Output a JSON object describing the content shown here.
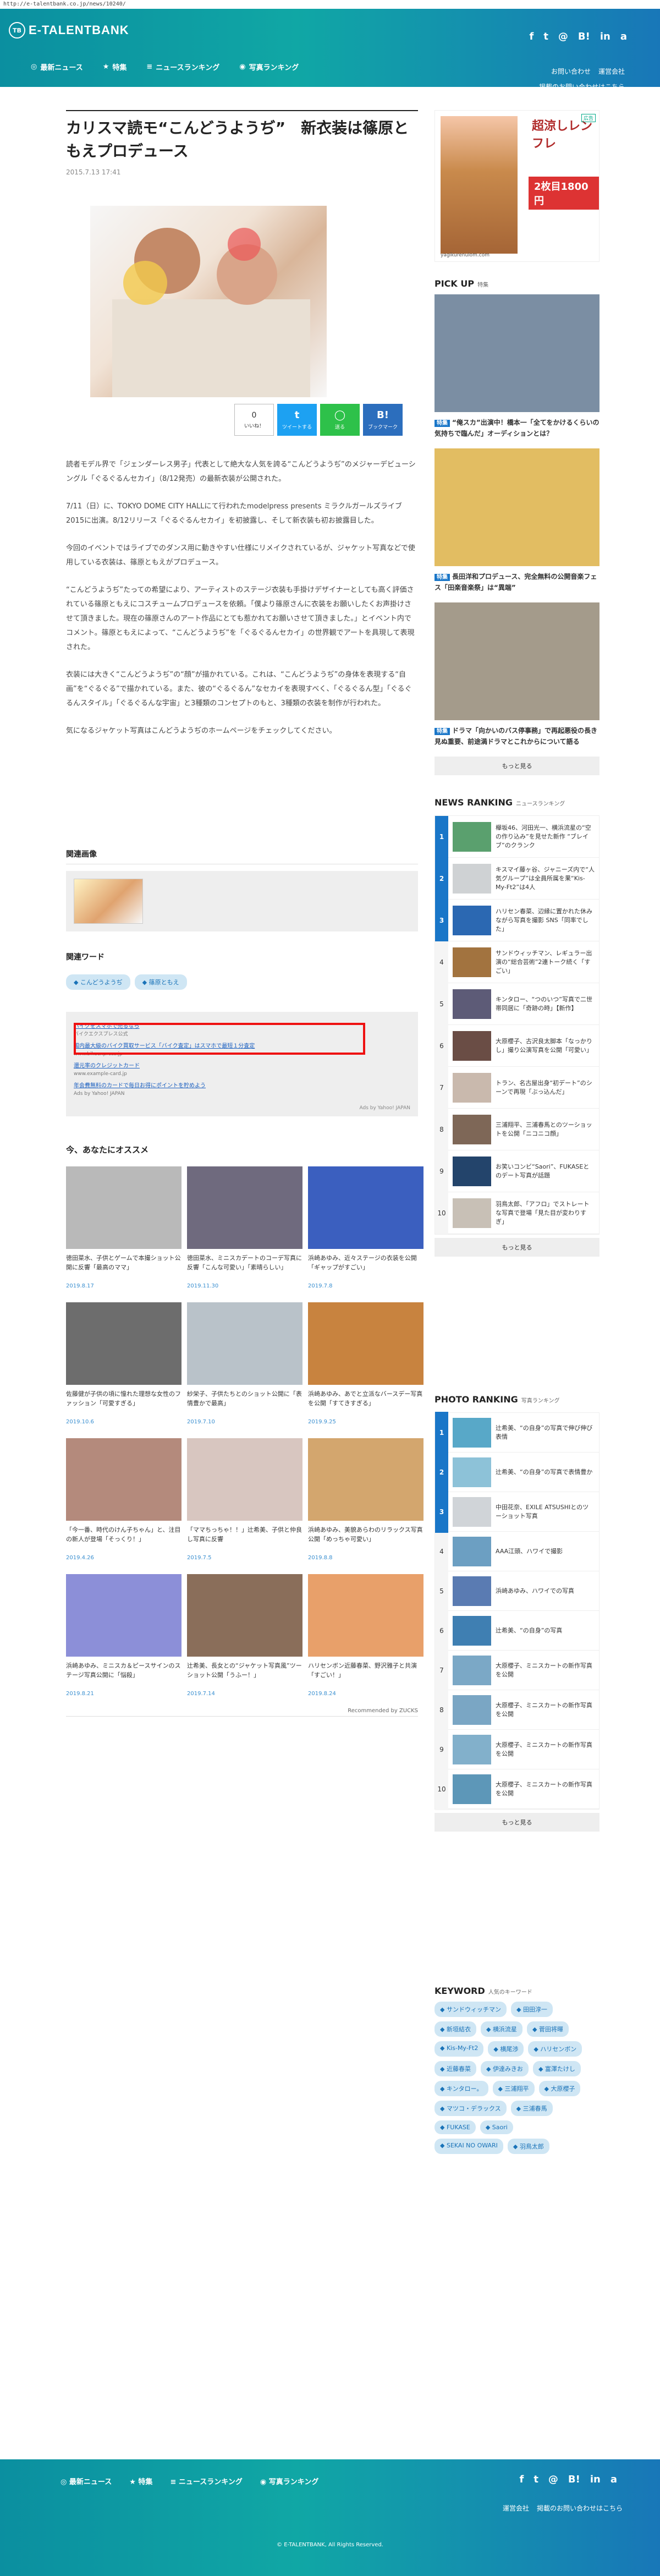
{
  "url": "http://e-talentbank.co.jp/news/10240/",
  "header": {
    "logo_mark": "TB",
    "logo_text": "E-TALENTBANK",
    "nav": [
      "最新ニュース",
      "特集",
      "ニュースランキング",
      "写真ランキング"
    ],
    "social": [
      "f",
      "t",
      "@",
      "B!",
      "in",
      "a"
    ],
    "links": [
      "お問い合わせ",
      "運営会社",
      "掲載のお問い合わせはこちら"
    ]
  },
  "article": {
    "title": "カリスマ読モ“こんどうようぢ”　新衣装は篠原ともえプロデュース",
    "date": "2015.7.13 17:41",
    "share": {
      "count": "0",
      "like_label": "いいね！",
      "tweet_label": "ツイートする",
      "line_label": "送る",
      "hatena_label": "ブックマーク"
    },
    "body": [
      "読者モデル界で「ジェンダーレス男子」代表として絶大な人気を誇る“こんどうようぢ”のメジャーデビューシングル「ぐるぐるんセカイ」（8/12発売）の最新衣装が公開された。",
      "7/11（日）に、TOKYO DOME CITY HALLにて行われたmodelpress presents ミラクルガールズライブ2015に出演。8/12リリース「ぐるぐるんセカイ」を初披露し、そして新衣装も初お披露目した。",
      "今回のイベントではライブでのダンス用に動きやすい仕様にリメイクされているが、ジャケット写真などで使用している衣装は、篠原ともえがプロデュース。",
      "“こんどうようぢ”たっての希望により、アーティストのステージ衣装も手掛けデザイナーとしても高く評価されている篠原ともえにコスチュームプロデュースを依頼。「僕より篠原さんに衣装をお願いしたくお声掛けさせて頂きました。現在の篠原さんのアート作品にとても惹かれてお願いさせて頂きました。」とイベント内でコメント。篠原ともえによって、“こんどうようぢ”を「ぐるぐるんセカイ」の世界観でアートを具現して表現された。",
      "衣装には大きく“こんどうようぢ”の“顔”が描かれている。これは、“こんどうようぢ”の身体を表現する“自画”を“ぐるぐる”で描かれている。また、彼の“ぐるぐるん”なセカイを表現すべく、「ぐるぐるん型」「ぐるぐるんスタイル」「ぐるぐるんな宇宙」と3種類のコンセプトのもと、3種類の衣装を制作が行われた。",
      "気になるジャケット写真はこんどうようぢのホームページをチェックしてください。"
    ]
  },
  "related": {
    "heading": "関連画像",
    "words_heading": "関連ワード",
    "tags": [
      "こんどうようぢ",
      "篠原ともえ"
    ]
  },
  "ad": {
    "lines": [
      {
        "title": "バイクをスマホで売るなら",
        "sub": "バイクエクスプレス公式"
      },
      {
        "title": "国内最大級のバイク買取サービス「バイク査定」はスマホで最短１分査定",
        "sub": "www.bikeexpress.jp"
      },
      {
        "title": "還元率のクレジットカード",
        "sub": "www.example-card.jp"
      },
      {
        "title": "年会費無料のカードで毎日お得にポイントを貯めよう",
        "sub": "Ads by Yahoo! JAPAN"
      }
    ],
    "ads_by": "Ads by Yahoo! JAPAN"
  },
  "recommend": {
    "heading": "今、あなたにオススメ",
    "items": [
      {
        "caption": "徳田菜水、子供とゲームで本撮ショット公開に反響「最高のママ」",
        "date": "2019.8.17",
        "color": "#b9b9b9"
      },
      {
        "caption": "徳田菜水、ミニスカデートのコーデ写真に反響「こんな可愛い」「素晴らしい」",
        "date": "2019.11.30",
        "color": "#6f6a7e"
      },
      {
        "caption": "浜崎あゆみ、近々ステージの衣装を公開「ギャップがすごい」",
        "date": "2019.7.8",
        "color": "#3b5fbf"
      },
      {
        "caption": "佐藤健が子供の頃に憧れた理想な女性のファッション「可愛すぎる」",
        "date": "2019.10.6",
        "color": "#6d6d6d"
      },
      {
        "caption": "紗栄子、子供たちとのショット公開に「表情豊かで最高」",
        "date": "2019.7.10",
        "color": "#b9c2c9"
      },
      {
        "caption": "浜崎あゆみ、あでと立派なバースデー写真を公開「すてきすぎる」",
        "date": "2019.9.25",
        "color": "#c8833f"
      },
      {
        "caption": "「今一番、時代のけん子ちゃん」と、注目の新人が登場「そっくり！」",
        "date": "2019.4.26",
        "color": "#b48a7c"
      },
      {
        "caption": "「ママちっちゃ！！」辻希美、子供と仲良し写真に反響",
        "date": "2019.7.5",
        "color": "#d8c6c0"
      },
      {
        "caption": "浜崎あゆみ、美貌あらわのリラックス写真公開「めっちゃ可愛い」",
        "date": "2019.8.8",
        "color": "#d3a66e"
      },
      {
        "caption": "浜崎あゆみ、ミニスカ＆ピースサインのステージ写真公開に「悩殺」",
        "date": "2019.8.21",
        "color": "#8c8fd8"
      },
      {
        "caption": "辻希美、長女との“ジャケット写真風”ツーショット公開「うふー！」",
        "date": "2019.7.14",
        "color": "#8a6e5a"
      },
      {
        "caption": "ハリセンボン近藤春菜、野沢雅子と共演「すごい！」",
        "date": "2019.8.24",
        "color": "#e8a06a"
      }
    ],
    "powered": "Recommended by ZUCKS"
  },
  "sidebar": {
    "ad": {
      "headline": "超涼しレンフレ",
      "price": "2枚目1800円",
      "domain": "yagikurenulom.com",
      "tag": "広告"
    },
    "pickup": {
      "heading": "PICK UP",
      "sub": "特集",
      "badge": "特集",
      "items": [
        {
          "caption": "“俺スカ”出演中！橋本一「全てをかけるくらいの気持ちで臨んだ」オーディションとは？",
          "color": "#7b8ea3"
        },
        {
          "caption": "長田洋和プロデュース、完全無料の公開音楽フェス「田楽音楽祭」は“異端”",
          "color": "#e2bd62"
        },
        {
          "caption": "ドラマ「向かいのバス停事務」で再起悪役の長き見ぬ重要、前途満ドラマとこれからについて語る",
          "color": "#a49b8b"
        }
      ],
      "more": "もっと見る"
    },
    "news_ranking": {
      "heading": "NEWS RANKING",
      "sub": "ニュースランキング",
      "items": [
        {
          "rank": "1",
          "text": "欅坂46、河田光一、横浜流星の“空の作り込み”を見せた新作 “ブレイブ”のクランク",
          "color": "#5aa06e"
        },
        {
          "rank": "2",
          "text": "キスマイ藤ヶ谷、ジャニーズ内で“人気グループ”は全員所属を果“Kis-My-Ft2”は4人",
          "color": "#cfd2d4"
        },
        {
          "rank": "3",
          "text": "ハリセン春菜、辺縁に置かれた休みながら写真を撮影 SNS「同率でした」",
          "color": "#2b68b2"
        },
        {
          "rank": "4",
          "text": "サンドウィッチマン、レギュラー出演の“総合芸術”2連トーク続く「すごい」",
          "color": "#a2733f"
        },
        {
          "rank": "5",
          "text": "キンタロー、“つのいつ”写真で二世帯同居に「奇跡の時」【新作】",
          "color": "#5d5b77"
        },
        {
          "rank": "6",
          "text": "大原櫻子、古沢良太脚本「なっかりし」撮り公演写真を公開「可愛い」",
          "color": "#6a4d45"
        },
        {
          "rank": "7",
          "text": "トラン、名古屋出身“初デート”のシーンで再現「ぶっ込んだ」",
          "color": "#c9b9ad"
        },
        {
          "rank": "8",
          "text": "三浦翔平、三浦春馬とのツーショットを公開「ニコニコ顔」",
          "color": "#7e6757"
        },
        {
          "rank": "9",
          "text": "お笑いコンビ“Saori”、FUKASEとのデート写真が話題",
          "color": "#23446b"
        },
        {
          "rank": "10",
          "text": "羽鳥太郎、「アフロ」でストレートな写真で登場「見た目が変わりすぎ」",
          "color": "#c8c0b6"
        }
      ],
      "more": "もっと見る"
    },
    "photo_ranking": {
      "heading": "PHOTO RANKING",
      "sub": "写真ランキング",
      "items": [
        {
          "rank": "1",
          "text": "辻希美、“の自身”の写真で伸び伸び表情",
          "color": "#58a8c8"
        },
        {
          "rank": "2",
          "text": "辻希美、“の自身”の写真で表情豊か",
          "color": "#8dc2d8"
        },
        {
          "rank": "3",
          "text": "中田花奈、EXILE ATSUSHIとのツーショット写真",
          "color": "#d0d4d8"
        },
        {
          "rank": "4",
          "text": "AAA江頭、ハワイで撮影",
          "color": "#6c9fc2"
        },
        {
          "rank": "5",
          "text": "浜崎あゆみ、ハワイでの写真",
          "color": "#5a7bb2"
        },
        {
          "rank": "6",
          "text": "辻希美、“の自身”の写真",
          "color": "#3f7fb2"
        },
        {
          "rank": "7",
          "text": "大原櫻子、ミニスカートの新作写真を公開",
          "color": "#7ba8c6"
        },
        {
          "rank": "8",
          "text": "大原櫻子、ミニスカートの新作写真を公開",
          "color": "#7aa6c4"
        },
        {
          "rank": "9",
          "text": "大原櫻子、ミニスカートの新作写真を公開",
          "color": "#82b0cb"
        },
        {
          "rank": "10",
          "text": "大原櫻子、ミニスカートの新作写真を公開",
          "color": "#5d97b8"
        }
      ],
      "more": "もっと見る"
    },
    "keyword": {
      "heading": "KEYWORD",
      "sub": "人気のキーワード",
      "items": [
        "サンドウィッチマン",
        "田田淳一",
        "新垣結衣",
        "横浜流星",
        "菅田将暉",
        "Kis-My-Ft2",
        "横尾渉",
        "ハリセンボン",
        "近藤春菜",
        "伊達みきお",
        "富澤たけし",
        "キンタロー。",
        "三浦翔平",
        "大原櫻子",
        "マツコ・デラックス",
        "三浦春馬",
        "FUKASE",
        "Saori",
        "SEKAI NO OWARI",
        "羽鳥太郎"
      ]
    }
  },
  "footer": {
    "nav": [
      "最新ニュース",
      "特集",
      "ニュースランキング",
      "写真ランキング"
    ],
    "social": [
      "f",
      "t",
      "@",
      "B!",
      "in",
      "a"
    ],
    "links": [
      "運営会社",
      "掲載のお問い合わせはこちら"
    ],
    "copyright": "© E-TALENTBANK, All Rights Reserved."
  }
}
